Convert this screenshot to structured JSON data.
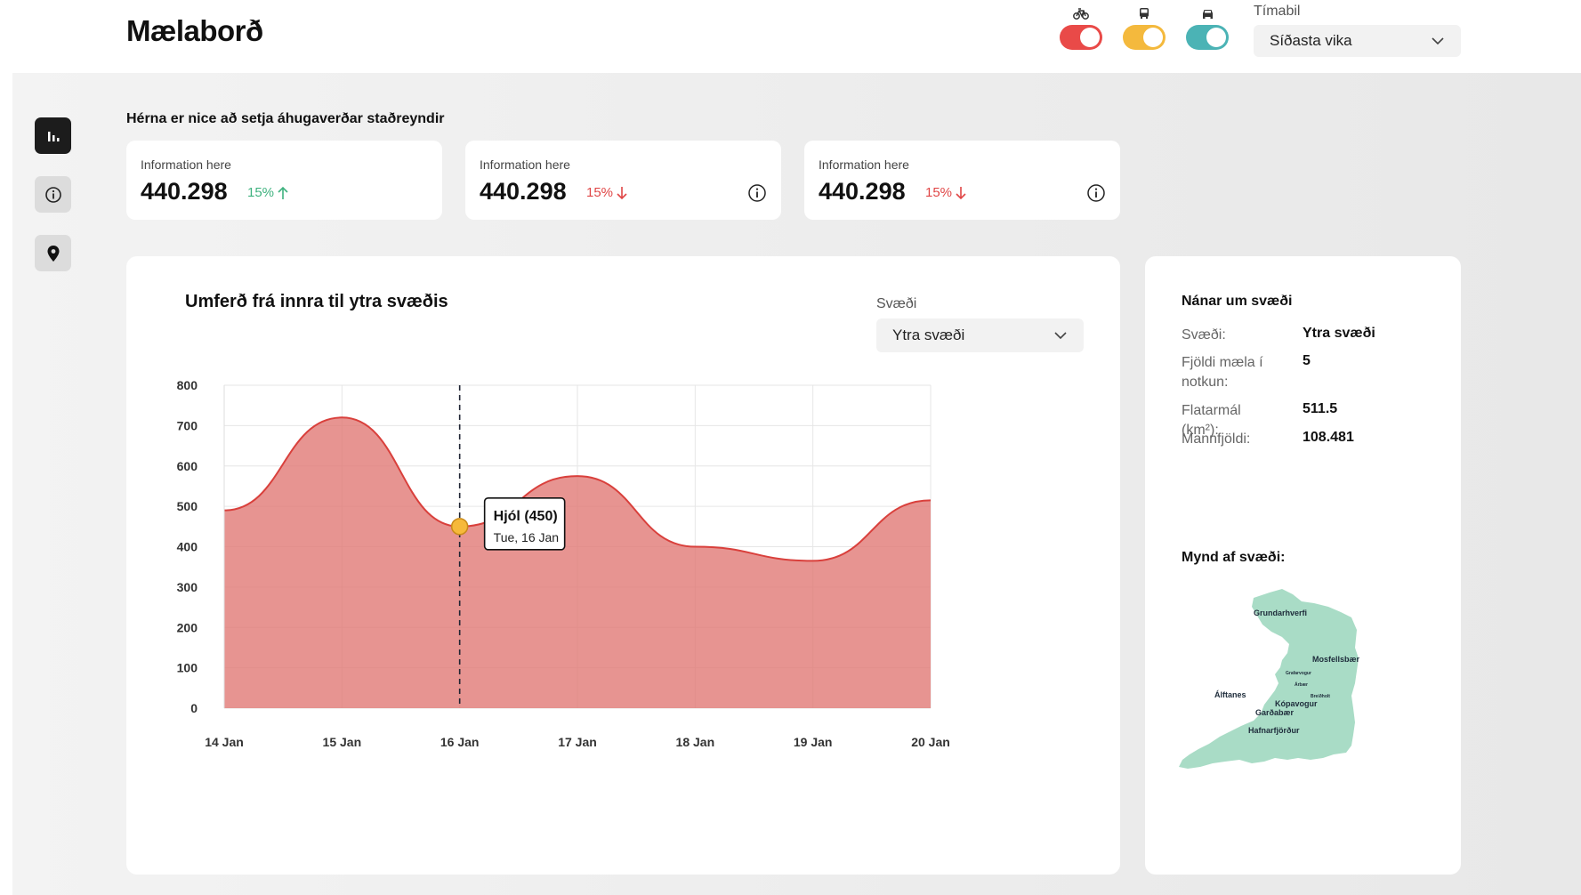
{
  "header": {
    "brand": "Mælaborð",
    "period_label": "Tímabil",
    "period_value": "Síðasta vika",
    "toggles": [
      {
        "name": "bike",
        "color": "#e94a48",
        "on": true
      },
      {
        "name": "bus",
        "color": "#f4b93d",
        "on": true
      },
      {
        "name": "car",
        "color": "#4bb3b5",
        "on": true
      }
    ]
  },
  "sidebar": {
    "items": [
      {
        "icon": "bar-chart-icon",
        "active": true
      },
      {
        "icon": "info-icon",
        "active": false
      },
      {
        "icon": "map-pin-icon",
        "active": false
      }
    ]
  },
  "facts": {
    "title": "Hérna er nice að setja áhugaverðar staðreyndir",
    "cards": [
      {
        "label": "Information here",
        "value": "440.298",
        "change": "15%",
        "trend": "up",
        "has_info": false
      },
      {
        "label": "Information here",
        "value": "440.298",
        "change": "15%",
        "trend": "down",
        "has_info": true
      },
      {
        "label": "Information here",
        "value": "440.298",
        "change": "15%",
        "trend": "down",
        "has_info": true
      }
    ]
  },
  "chart_panel": {
    "title": "Umferð frá innra til ytra svæðis",
    "region_label": "Svæði",
    "region_value": "Ytra svæði"
  },
  "chart_data": {
    "type": "area",
    "title": "Umferð frá innra til ytra svæðis",
    "categories": [
      "14 Jan",
      "15 Jan",
      "16 Jan",
      "17 Jan",
      "18 Jan",
      "19 Jan",
      "20 Jan"
    ],
    "series": [
      {
        "name": "Hjól",
        "values": [
          490,
          720,
          450,
          575,
          400,
          365,
          515
        ],
        "color": "#e07672"
      }
    ],
    "ylim": [
      0,
      800
    ],
    "yticks": [
      0,
      100,
      200,
      300,
      400,
      500,
      600,
      700,
      800
    ],
    "grid": true,
    "tooltip": {
      "index": 2,
      "title": "Hjól (450)",
      "subtitle": "Tue, 16 Jan"
    }
  },
  "details": {
    "title": "Nánar um svæði",
    "rows": [
      {
        "key": "Svæði:",
        "value": "Ytra svæði"
      },
      {
        "key": "Fjöldi mæla í notkun:",
        "value": "5"
      },
      {
        "key": "Flatarmál (km²):",
        "value": "511.5"
      },
      {
        "key": "Mannfjöldi:",
        "value": "108.481"
      }
    ],
    "map_title": "Mynd af svæði:",
    "map_labels": [
      "Grundarhverfi",
      "Mosfellsbær",
      "Grafarvogur",
      "Árbær",
      "Breiðholt",
      "Álftanes",
      "Kópavogur",
      "Garðabær",
      "Hafnarfjörður"
    ],
    "map_color": "#a9dcc6"
  }
}
